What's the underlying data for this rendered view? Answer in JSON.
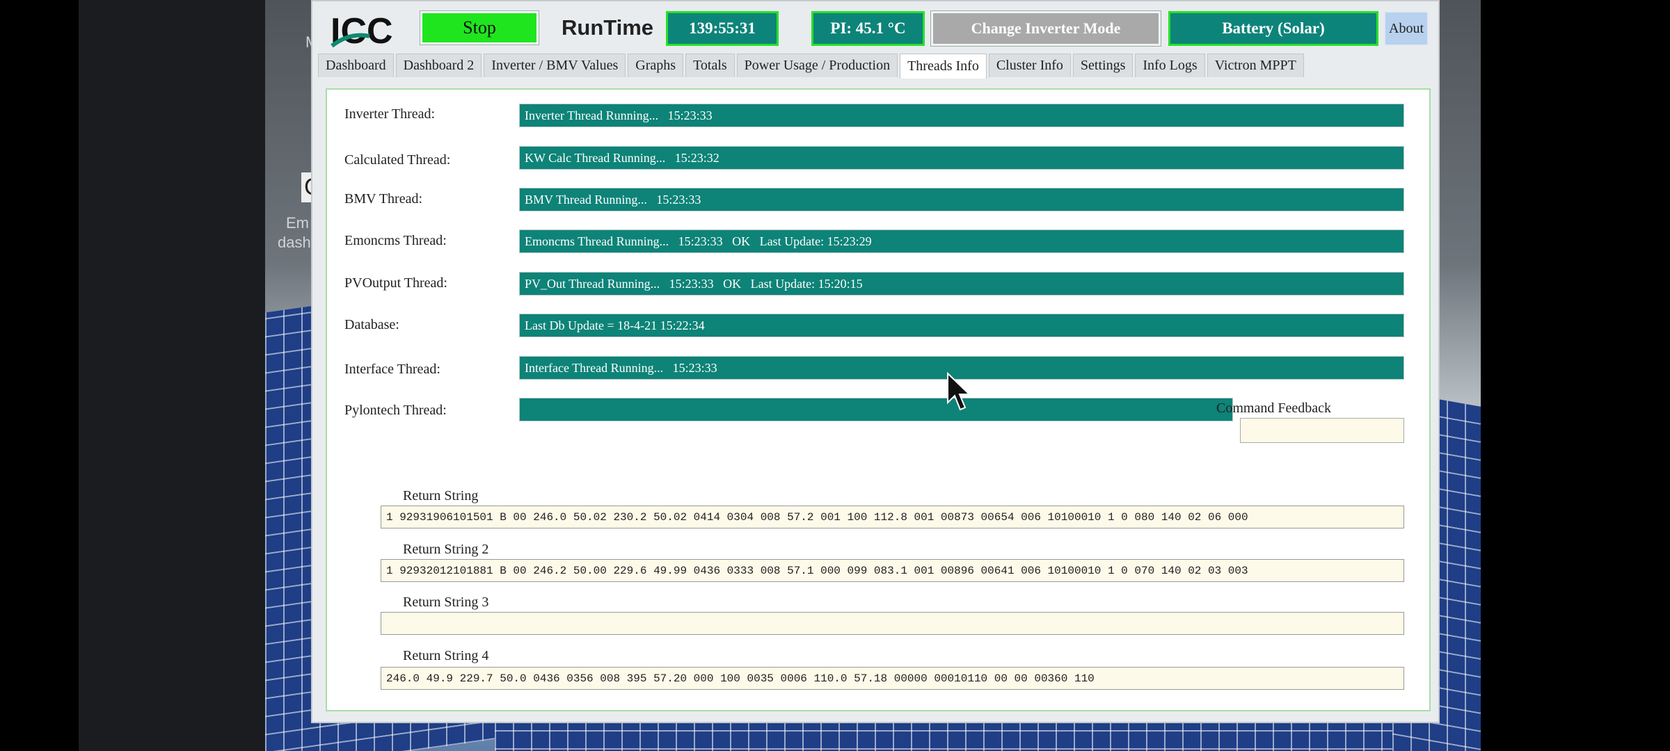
{
  "desktop": {
    "fragment_1": "M",
    "fragment_2": "C",
    "fragment_3": "Em",
    "fragment_4": "dash"
  },
  "header": {
    "stop_label": "Stop",
    "runtime_label": "RunTime",
    "runtime_value": "139:55:31",
    "pi_temp": "PI: 45.1 °C",
    "mode_button": "Change Inverter Mode",
    "battery_mode": "Battery (Solar)",
    "about_label": "About"
  },
  "tabs": [
    {
      "label": "Dashboard"
    },
    {
      "label": "Dashboard 2"
    },
    {
      "label": "Inverter / BMV Values"
    },
    {
      "label": "Graphs"
    },
    {
      "label": "Totals"
    },
    {
      "label": "Power Usage / Production"
    },
    {
      "label": "Threads Info",
      "active": true
    },
    {
      "label": "Cluster Info"
    },
    {
      "label": "Settings"
    },
    {
      "label": "Info Logs"
    },
    {
      "label": "Victron MPPT"
    }
  ],
  "threads": [
    {
      "label": "Inverter Thread:",
      "status": "Inverter Thread Running...   15:23:33"
    },
    {
      "label": "Calculated Thread:",
      "status": "KW Calc Thread Running...   15:23:32"
    },
    {
      "label": "BMV Thread:",
      "status": "BMV Thread Running...   15:23:33"
    },
    {
      "label": "Emoncms Thread:",
      "status": "Emoncms Thread Running...   15:23:33   OK   Last Update: 15:23:29"
    },
    {
      "label": "PVOutput Thread:",
      "status": "PV_Out Thread Running...   15:23:33   OK   Last Update: 15:20:15"
    },
    {
      "label": "Database:",
      "status": "Last Db Update = 18-4-21 15:22:34"
    },
    {
      "label": "Interface Thread:",
      "status": "Interface Thread Running...   15:23:33"
    },
    {
      "label": "Pylontech Thread:",
      "status": ""
    }
  ],
  "command_feedback": {
    "label": "Command Feedback",
    "value": ""
  },
  "return_strings": [
    {
      "label": "Return String",
      "value": "1 92931906101501 B 00 246.0 50.02 230.2 50.02 0414 0304 008 57.2 001 100 112.8 001 00873 00654 006 10100010 1 0 080 140 02 06 000"
    },
    {
      "label": "Return String 2",
      "value": "1 92932012101881 B 00 246.2 50.00 229.6 49.99 0436 0333 008 57.1 000 099 083.1 001 00896 00641 006 10100010 1 0 070 140 02 03 003"
    },
    {
      "label": "Return String 3",
      "value": ""
    },
    {
      "label": "Return String 4",
      "value": "246.0 49.9 229.7 50.0 0436 0356 008 395 57.20 000 100 0035 0006 110.0 57.18 00000 00010110 00 00 00360 110"
    }
  ],
  "colors": {
    "teal": "#0e8378",
    "green": "#1fe51f",
    "stat_border": "#27e227",
    "about_bg": "#b7d1ee"
  }
}
